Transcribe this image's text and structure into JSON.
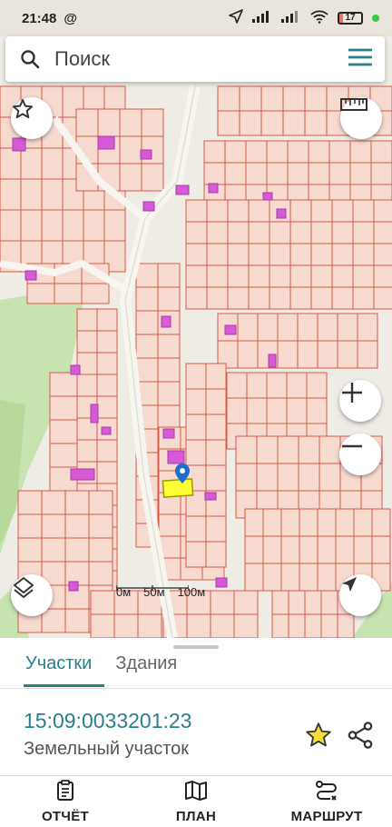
{
  "status_bar": {
    "time": "21:48",
    "at_symbol": "@",
    "battery_level": "17",
    "battery_fraction": 0.17
  },
  "search": {
    "placeholder": "Поиск"
  },
  "map": {
    "scale": {
      "label_0": "0м",
      "label_50": "50м",
      "label_100": "100м"
    },
    "colors": {
      "background": "#efece6",
      "parcel_stroke": "#d55a4a",
      "parcel_fill": "#f6d9cf",
      "building": "#d65ad6",
      "green": "#c7e3b0",
      "road": "#f7f5ef",
      "selected": "#ffff33",
      "marker": "#1e6fc8"
    }
  },
  "controls": {
    "favorites_icon": "star-outline-icon",
    "ruler_icon": "ruler-icon",
    "zoom_in_icon": "plus-icon",
    "zoom_out_icon": "minus-icon",
    "layers_icon": "layers-icon",
    "locate_icon": "navigation-arrow-icon"
  },
  "sheet": {
    "tabs": [
      {
        "label": "Участки",
        "active": true
      },
      {
        "label": "Здания",
        "active": false
      }
    ],
    "parcel": {
      "number": "15:09:0033201:23",
      "type": "Земельный участок"
    }
  },
  "bottom_nav": [
    {
      "label": "ОТЧЁТ",
      "icon": "report-icon"
    },
    {
      "label": "ПЛАН",
      "icon": "map-icon"
    },
    {
      "label": "МАРШРУТ",
      "icon": "route-icon"
    }
  ],
  "accent_color": "#2a7f8f"
}
